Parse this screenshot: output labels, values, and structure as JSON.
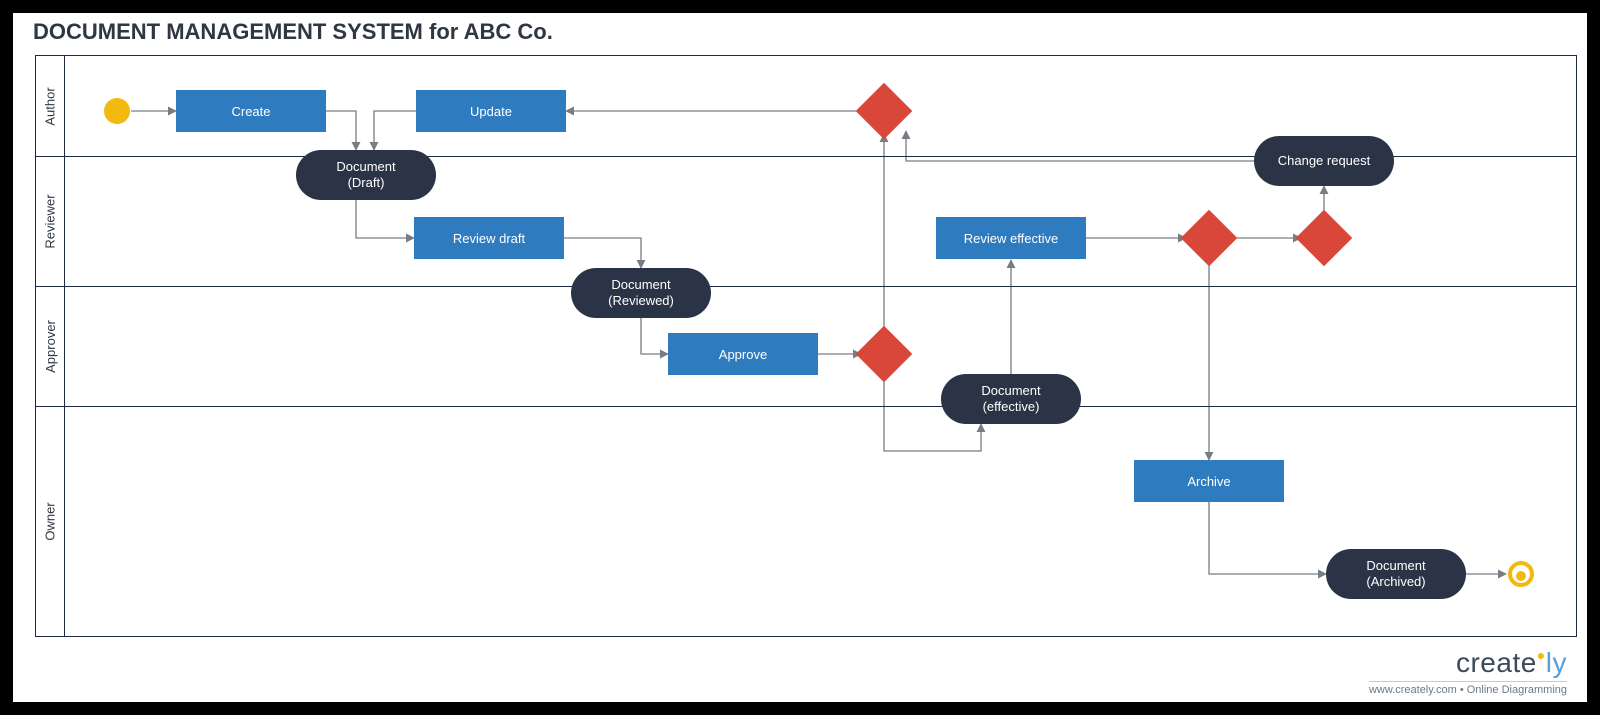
{
  "title": "DOCUMENT MANAGEMENT SYSTEM for ABC Co.",
  "lanes": {
    "author": "Author",
    "reviewer": "Reviewer",
    "approver": "Approver",
    "owner": "Owner"
  },
  "nodes": {
    "create": "Create",
    "update": "Update",
    "doc_draft": "Document\n(Draft)",
    "review_draft": "Review draft",
    "doc_reviewed": "Document\n(Reviewed)",
    "approve": "Approve",
    "doc_effective": "Document\n(effective)",
    "review_effective": "Review effective",
    "change_request": "Change request",
    "archive": "Archive",
    "doc_archived": "Document\n(Archived)"
  },
  "footer": {
    "brand_a": "creat",
    "brand_b": "e",
    "brand_c": "ly",
    "tagline": "www.creately.com • Online Diagramming"
  },
  "colors": {
    "activity": "#2f7bbf",
    "object": "#2b3346",
    "decision": "#d9463a",
    "start": "#f2b90f",
    "border": "#1e2a44",
    "edge": "#777d85"
  }
}
